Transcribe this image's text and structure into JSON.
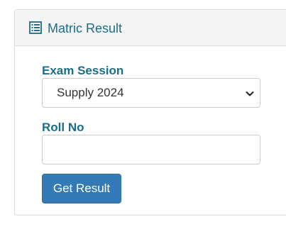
{
  "panel": {
    "title": "Matric Result",
    "title_icon": "list-icon"
  },
  "form": {
    "exam_session": {
      "label": "Exam Session",
      "selected": "Supply 2024",
      "dropdown_icon": "chevron-down-icon"
    },
    "roll_no": {
      "label": "Roll No",
      "value": "",
      "placeholder": ""
    },
    "submit_label": "Get Result"
  },
  "colors": {
    "heading_text": "#1a6e8a",
    "header_background": "#f5f5f5",
    "primary_button": "#337ab7",
    "border": "#cccccc"
  }
}
